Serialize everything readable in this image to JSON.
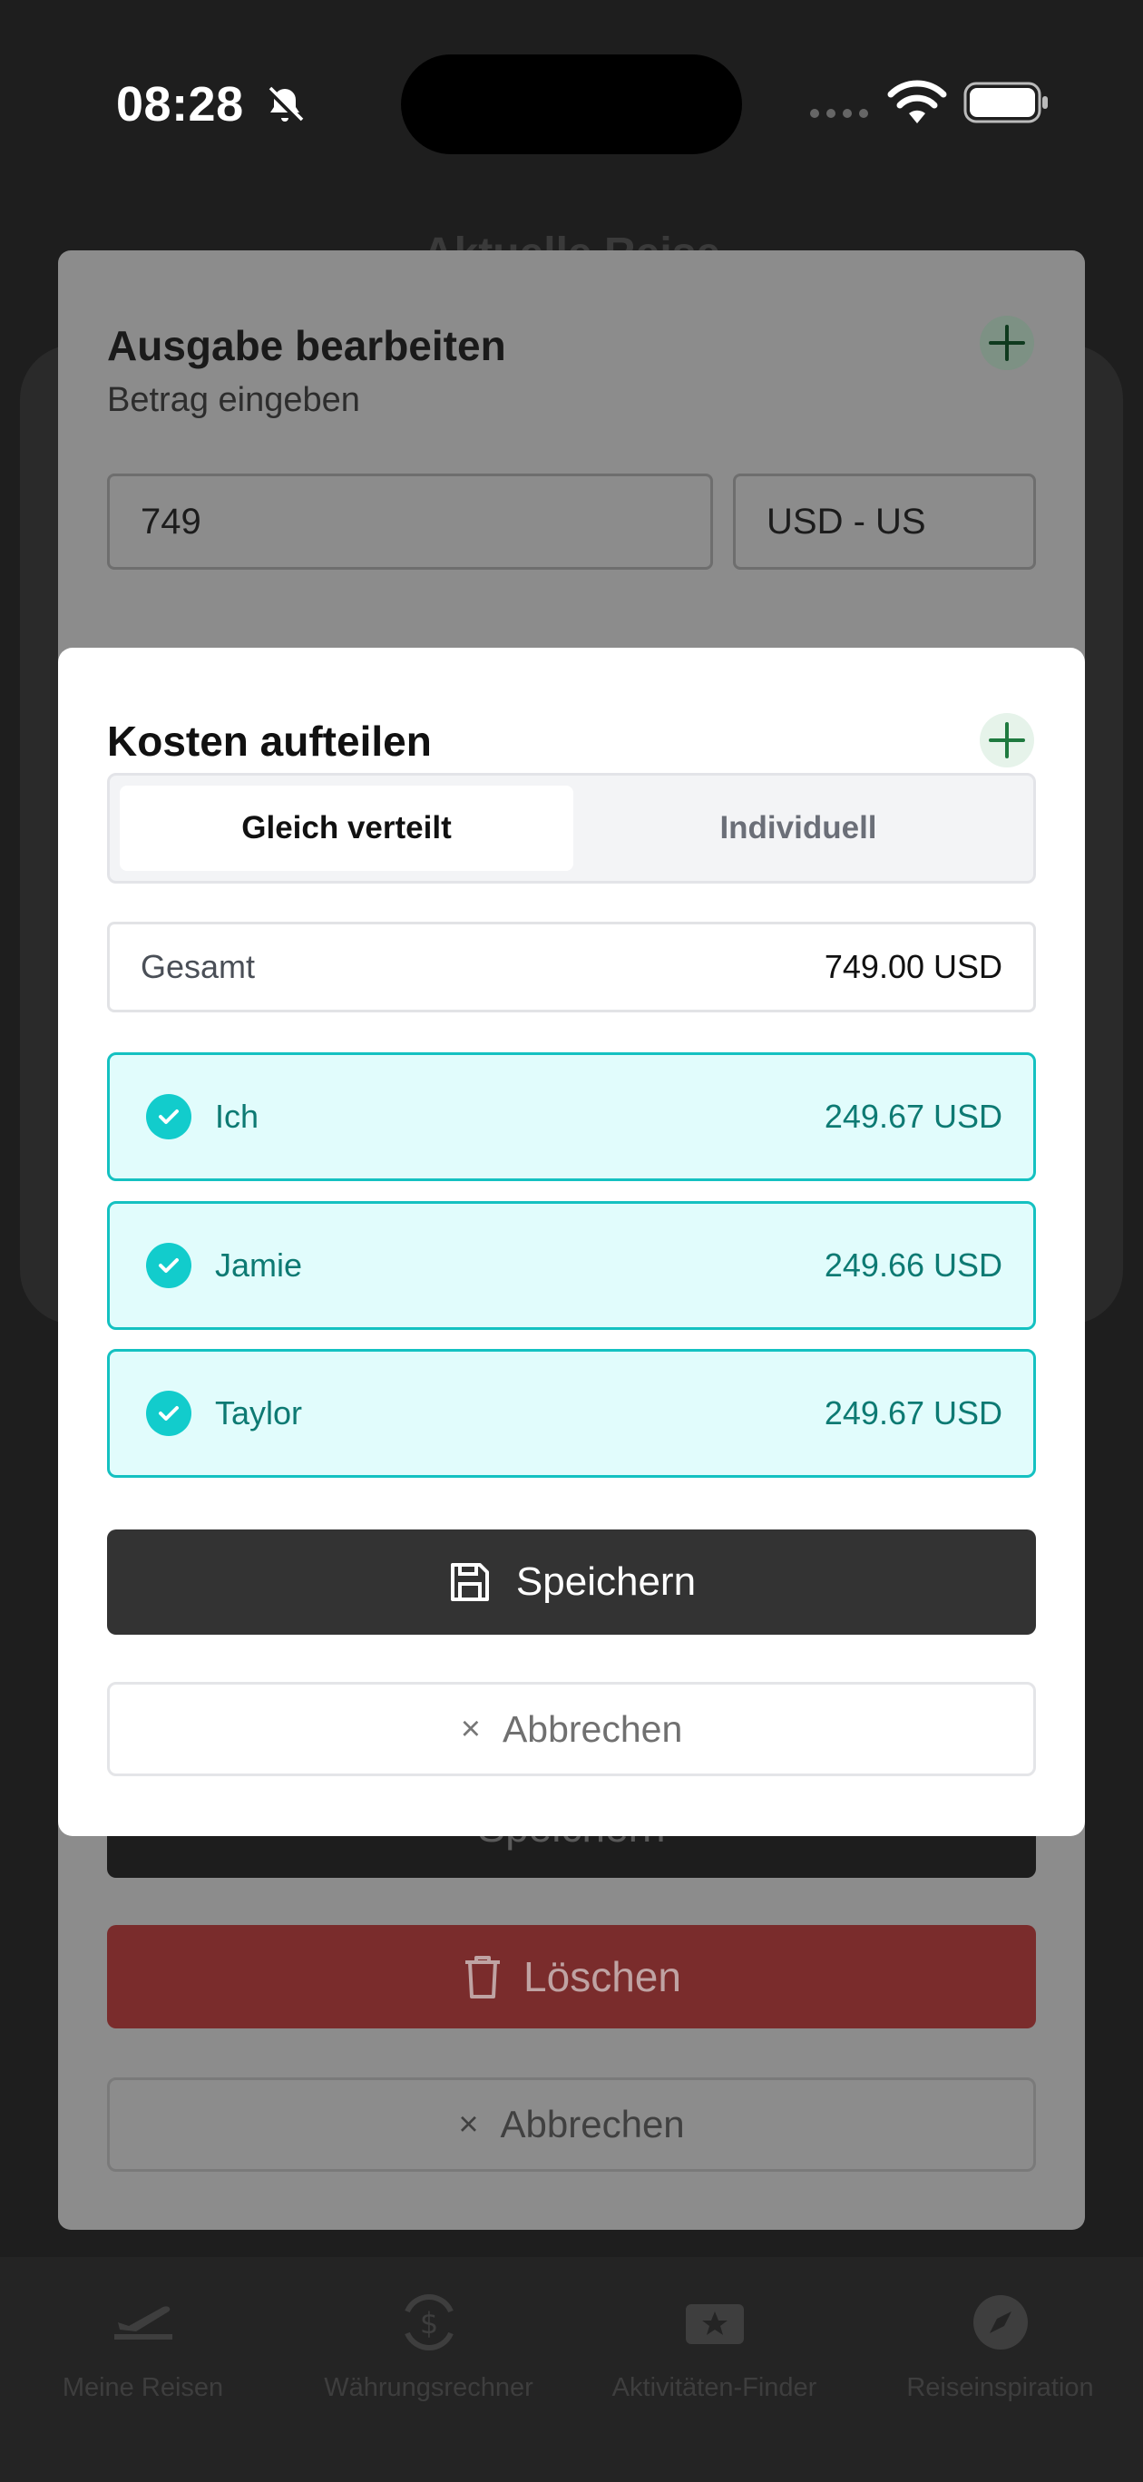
{
  "status_bar": {
    "time": "08:28"
  },
  "background": {
    "header_title": "Aktuelle Reise",
    "bottom_nav": [
      {
        "label": "Meine Reisen",
        "icon": "plane-departure-icon"
      },
      {
        "label": "Währungsrechner",
        "icon": "currency-exchange-icon"
      },
      {
        "label": "Aktivitäten-Finder",
        "icon": "ticket-star-icon"
      },
      {
        "label": "Reiseinspiration",
        "icon": "compass-icon"
      }
    ]
  },
  "edit_sheet": {
    "title": "Ausgabe bearbeiten",
    "subtitle": "Betrag eingeben",
    "amount_value": "749",
    "currency_value": "USD - US",
    "save_label": "Speichern",
    "delete_label": "Löschen",
    "cancel_label": "Abbrechen"
  },
  "split_modal": {
    "title": "Kosten aufteilen",
    "tabs": [
      {
        "label": "Gleich verteilt",
        "active": true
      },
      {
        "label": "Individuell",
        "active": false
      }
    ],
    "total_label": "Gesamt",
    "total_value": "749.00 USD",
    "participants": [
      {
        "name": "Ich",
        "amount": "249.67 USD",
        "checked": true
      },
      {
        "name": "Jamie",
        "amount": "249.66 USD",
        "checked": true
      },
      {
        "name": "Taylor",
        "amount": "249.67 USD",
        "checked": true
      }
    ],
    "save_label": "Speichern",
    "cancel_label": "Abbrechen"
  },
  "colors": {
    "accent_teal": "#12cccc",
    "participant_bg": "#e1fcfc",
    "primary_button": "#333333",
    "delete_button": "#7a2c2c",
    "plus_green": "#1f7a3f"
  }
}
